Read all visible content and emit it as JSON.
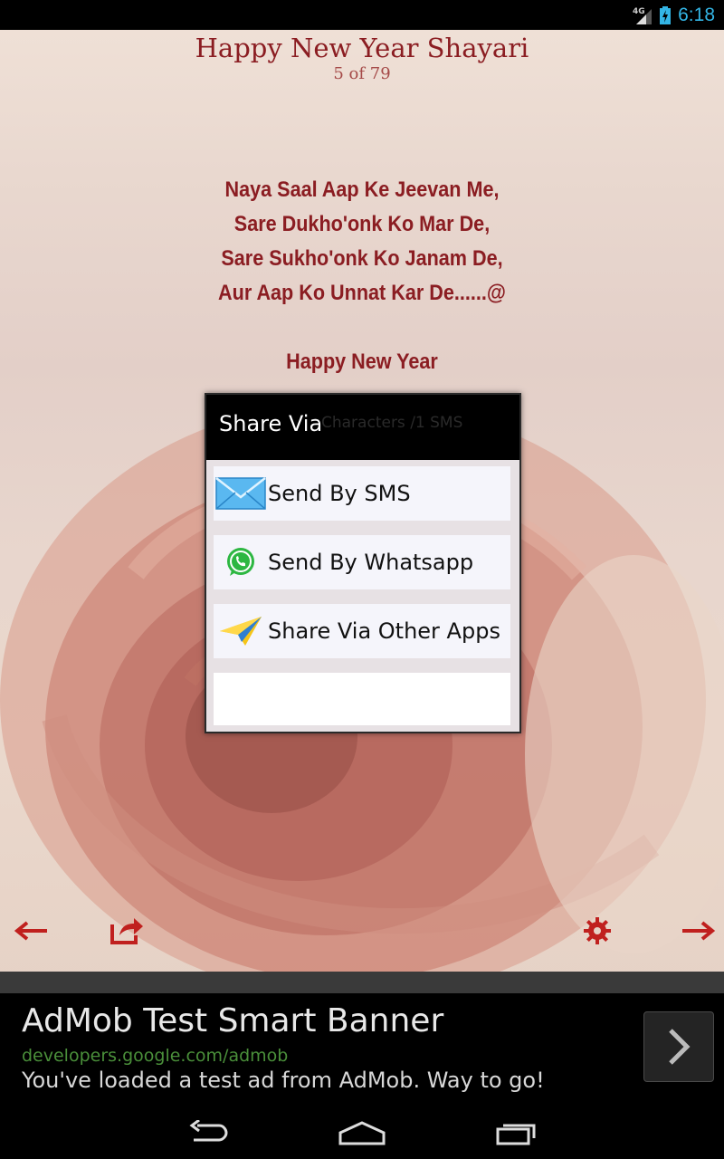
{
  "status_bar": {
    "network": "4G",
    "time": "6:18"
  },
  "app": {
    "title": "Happy New Year Shayari",
    "counter": "5 of 79",
    "shayari_lines": [
      "Naya Saal Aap Ke Jeevan Me,",
      "Sare Dukho'onk Ko Mar De,",
      "Sare Sukho'onk Ko Janam De,",
      "Aur Aap Ko Unnat Kar De......@"
    ],
    "shayari_closing": "Happy New Year",
    "char_count": "Characters /1 SMS"
  },
  "dialog": {
    "title": "Share Via",
    "options": [
      {
        "label": "Send By SMS",
        "icon": "envelope-icon"
      },
      {
        "label": "Send By Whatsapp",
        "icon": "whatsapp-icon"
      },
      {
        "label": "Share Via Other Apps",
        "icon": "paper-plane-icon"
      }
    ]
  },
  "controls": {
    "prev": "left-arrow-icon",
    "share": "share-icon",
    "settings": "gear-icon",
    "next": "right-arrow-icon"
  },
  "ad": {
    "title": "AdMob Test Smart Banner",
    "url": "developers.google.com/admob",
    "description": "You've loaded a test ad from AdMob. Way to go!"
  },
  "colors": {
    "accent_red": "#8b1d22",
    "status_blue": "#33b5e5",
    "ad_url_green": "#4a8f3a"
  }
}
